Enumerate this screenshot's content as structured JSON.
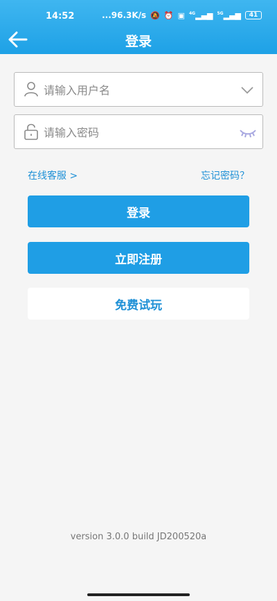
{
  "status_bar": {
    "time": "14:52",
    "network_speed": "...96.3K/s",
    "net_labels": [
      "4G",
      "5G"
    ],
    "battery": "41"
  },
  "nav": {
    "title": "登录",
    "back_icon": "arrow-left-icon"
  },
  "form": {
    "username_placeholder": "请输入用户名",
    "password_placeholder": "请输入密码",
    "username_icon": "user-icon",
    "password_icon": "lock-icon",
    "dropdown_icon": "chevron-down-icon",
    "visibility_icon": "eye-closed-icon"
  },
  "links": {
    "customer_service": "在线客服 >",
    "forgot_password": "忘记密码？"
  },
  "buttons": {
    "login": "登录",
    "register": "立即注册",
    "free_trial": "免费试玩"
  },
  "footer": {
    "version": "version 3.0.0  build JD200520a"
  },
  "colors": {
    "accent": "#1f9ee5",
    "link": "#1e90d6",
    "background": "#f5f5f5"
  }
}
